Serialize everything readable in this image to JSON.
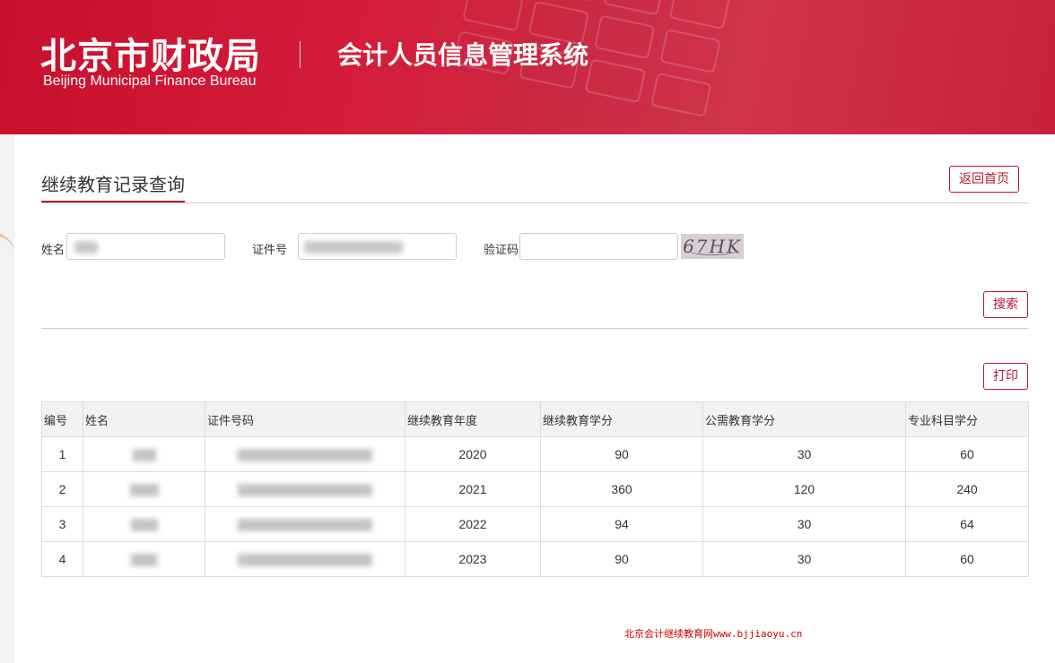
{
  "header": {
    "org_cn": "北京市财政局",
    "org_en": "Beijing Municipal Finance Bureau",
    "system_title": "会计人员信息管理系统"
  },
  "page": {
    "section_title": "继续教育记录查询",
    "back_home_label": "返回首页"
  },
  "search_form": {
    "name_label": "姓名",
    "id_label": "证件号",
    "captcha_label": "验证码",
    "captcha_text": "67HK",
    "search_label": "搜索"
  },
  "results": {
    "print_label": "打印",
    "columns": [
      "编号",
      "姓名",
      "证件号码",
      "继续教育年度",
      "继续教育学分",
      "公需教育学分",
      "专业科目学分"
    ],
    "rows": [
      {
        "no": "1",
        "year": "2020",
        "total": "90",
        "public": "30",
        "professional": "60"
      },
      {
        "no": "2",
        "year": "2021",
        "total": "360",
        "public": "120",
        "professional": "240"
      },
      {
        "no": "3",
        "year": "2022",
        "total": "94",
        "public": "30",
        "professional": "64"
      },
      {
        "no": "4",
        "year": "2023",
        "total": "90",
        "public": "30",
        "professional": "60"
      }
    ]
  },
  "watermark": {
    "site_name": "北京会计继续教育网",
    "url": "www.bjjiaoyu.cn"
  },
  "colors": {
    "brand_red": "#c8102e",
    "accent_red": "#b5172f"
  }
}
